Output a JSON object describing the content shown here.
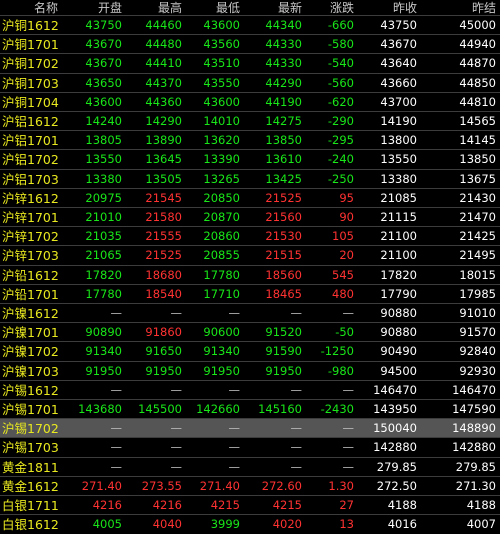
{
  "header": {
    "name": "名称",
    "open": "开盘",
    "high": "最高",
    "low": "最低",
    "last": "最新",
    "change": "涨跌",
    "prev_close": "昨收",
    "prev_settle": "昨结"
  },
  "colors": {
    "background": "#000000",
    "name": "#e8e820",
    "up": "#ff3232",
    "down": "#19e619",
    "neutral": "#ffffff",
    "selected_row": "#555555"
  },
  "rows": [
    {
      "name": "沪铜1612",
      "open": "43750",
      "high": "44460",
      "low": "43600",
      "last": "44340",
      "change": "-660",
      "prev_close": "43750",
      "prev_settle": "45000"
    },
    {
      "name": "沪铜1701",
      "open": "43670",
      "high": "44480",
      "low": "43560",
      "last": "44330",
      "change": "-580",
      "prev_close": "43670",
      "prev_settle": "44940"
    },
    {
      "name": "沪铜1702",
      "open": "43670",
      "high": "44410",
      "low": "43510",
      "last": "44330",
      "change": "-540",
      "prev_close": "43640",
      "prev_settle": "44870"
    },
    {
      "name": "沪铜1703",
      "open": "43650",
      "high": "44370",
      "low": "43550",
      "last": "44290",
      "change": "-560",
      "prev_close": "43660",
      "prev_settle": "44850"
    },
    {
      "name": "沪铜1704",
      "open": "43600",
      "high": "44360",
      "low": "43600",
      "last": "44190",
      "change": "-620",
      "prev_close": "43700",
      "prev_settle": "44810"
    },
    {
      "name": "沪铝1612",
      "open": "14240",
      "high": "14290",
      "low": "14010",
      "last": "14275",
      "change": "-290",
      "prev_close": "14190",
      "prev_settle": "14565"
    },
    {
      "name": "沪铝1701",
      "open": "13805",
      "high": "13890",
      "low": "13620",
      "last": "13850",
      "change": "-295",
      "prev_close": "13800",
      "prev_settle": "14145"
    },
    {
      "name": "沪铝1702",
      "open": "13550",
      "high": "13645",
      "low": "13390",
      "last": "13610",
      "change": "-240",
      "prev_close": "13550",
      "prev_settle": "13850"
    },
    {
      "name": "沪铝1703",
      "open": "13380",
      "high": "13505",
      "low": "13265",
      "last": "13425",
      "change": "-250",
      "prev_close": "13380",
      "prev_settle": "13675"
    },
    {
      "name": "沪锌1612",
      "open": "20975",
      "high": "21545",
      "low": "20850",
      "last": "21525",
      "change": "95",
      "prev_close": "21085",
      "prev_settle": "21430"
    },
    {
      "name": "沪锌1701",
      "open": "21010",
      "high": "21580",
      "low": "20870",
      "last": "21560",
      "change": "90",
      "prev_close": "21115",
      "prev_settle": "21470"
    },
    {
      "name": "沪锌1702",
      "open": "21035",
      "high": "21555",
      "low": "20860",
      "last": "21530",
      "change": "105",
      "prev_close": "21100",
      "prev_settle": "21425"
    },
    {
      "name": "沪锌1703",
      "open": "21065",
      "high": "21525",
      "low": "20855",
      "last": "21515",
      "change": "20",
      "prev_close": "21100",
      "prev_settle": "21495"
    },
    {
      "name": "沪铅1612",
      "open": "17820",
      "high": "18680",
      "low": "17780",
      "last": "18560",
      "change": "545",
      "prev_close": "17820",
      "prev_settle": "18015"
    },
    {
      "name": "沪铅1701",
      "open": "17780",
      "high": "18540",
      "low": "17710",
      "last": "18465",
      "change": "480",
      "prev_close": "17790",
      "prev_settle": "17985"
    },
    {
      "name": "沪镍1612",
      "open": "—",
      "high": "—",
      "low": "—",
      "last": "—",
      "change": "—",
      "prev_close": "90880",
      "prev_settle": "91010"
    },
    {
      "name": "沪镍1701",
      "open": "90890",
      "high": "91860",
      "low": "90600",
      "last": "91520",
      "change": "-50",
      "prev_close": "90880",
      "prev_settle": "91570"
    },
    {
      "name": "沪镍1702",
      "open": "91340",
      "high": "91650",
      "low": "91340",
      "last": "91590",
      "change": "-1250",
      "prev_close": "90490",
      "prev_settle": "92840"
    },
    {
      "name": "沪镍1703",
      "open": "91950",
      "high": "91950",
      "low": "91950",
      "last": "91950",
      "change": "-980",
      "prev_close": "94500",
      "prev_settle": "92930"
    },
    {
      "name": "沪锡1612",
      "open": "—",
      "high": "—",
      "low": "—",
      "last": "—",
      "change": "—",
      "prev_close": "146470",
      "prev_settle": "146470"
    },
    {
      "name": "沪锡1701",
      "open": "143680",
      "high": "145500",
      "low": "142660",
      "last": "145160",
      "change": "-2430",
      "prev_close": "143950",
      "prev_settle": "147590"
    },
    {
      "name": "沪锡1702",
      "open": "—",
      "high": "—",
      "low": "—",
      "last": "—",
      "change": "—",
      "prev_close": "150040",
      "prev_settle": "148890"
    },
    {
      "name": "沪锡1703",
      "open": "—",
      "high": "—",
      "low": "—",
      "last": "—",
      "change": "—",
      "prev_close": "142880",
      "prev_settle": "142880"
    },
    {
      "name": "黄金1811",
      "open": "—",
      "high": "—",
      "low": "—",
      "last": "—",
      "change": "—",
      "prev_close": "279.85",
      "prev_settle": "279.85"
    },
    {
      "name": "黄金1612",
      "open": "271.40",
      "high": "273.55",
      "low": "271.40",
      "last": "272.60",
      "change": "1.30",
      "prev_close": "272.50",
      "prev_settle": "271.30"
    },
    {
      "name": "白银1711",
      "open": "4216",
      "high": "4216",
      "low": "4215",
      "last": "4215",
      "change": "27",
      "prev_close": "4188",
      "prev_settle": "4188"
    },
    {
      "name": "白银1612",
      "open": "4005",
      "high": "4040",
      "low": "3999",
      "last": "4020",
      "change": "13",
      "prev_close": "4016",
      "prev_settle": "4007"
    }
  ]
}
